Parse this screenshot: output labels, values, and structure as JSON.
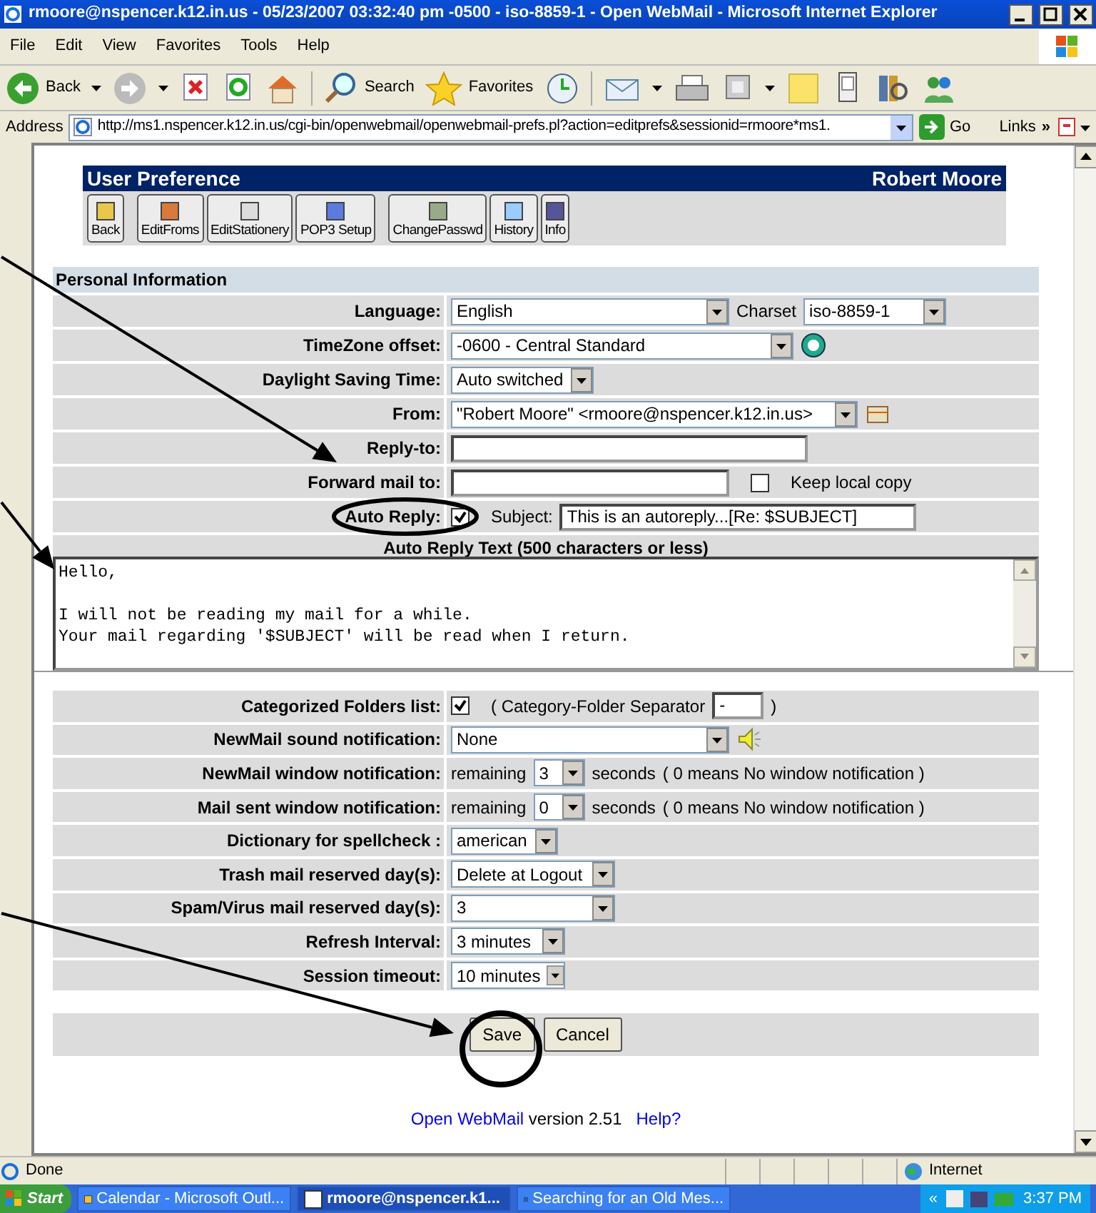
{
  "window": {
    "title": "rmoore@nspencer.k12.in.us - 05/23/2007 03:32:40 pm -0500 - iso-8859-1 - Open WebMail - Microsoft Internet Explorer"
  },
  "menu": [
    "File",
    "Edit",
    "View",
    "Favorites",
    "Tools",
    "Help"
  ],
  "toolbar": [
    {
      "kind": "back",
      "label": "Back"
    },
    {
      "kind": "caret"
    },
    {
      "kind": "forward"
    },
    {
      "kind": "caret"
    },
    {
      "kind": "stop"
    },
    {
      "kind": "refresh"
    },
    {
      "kind": "home"
    },
    {
      "kind": "sep"
    },
    {
      "kind": "search",
      "label": "Search"
    },
    {
      "kind": "favorites",
      "label": "Favorites"
    },
    {
      "kind": "media"
    },
    {
      "kind": "sep"
    },
    {
      "kind": "mail"
    },
    {
      "kind": "caret"
    },
    {
      "kind": "print"
    },
    {
      "kind": "edit"
    },
    {
      "kind": "caret"
    },
    {
      "kind": "note"
    },
    {
      "kind": "device"
    },
    {
      "kind": "research"
    },
    {
      "kind": "messenger"
    }
  ],
  "address": {
    "label": "Address",
    "url": "http://ms1.nspencer.k12.in.us/cgi-bin/openwebmail/openwebmail-prefs.pl?action=editprefs&sessionid=rmoore*ms1.",
    "go": "Go",
    "links": "Links",
    "more": "»"
  },
  "prefs": {
    "title": "User Preference",
    "user": "Robert Moore",
    "tools": [
      "Back",
      "EditFroms",
      "EditStationery",
      "POP3 Setup",
      "ChangePasswd",
      "History",
      "Info"
    ],
    "section": "Personal Information",
    "rows": [
      {
        "label": "Language:",
        "controls": [
          {
            "kind": "select",
            "value": "English"
          },
          {
            "kind": "text",
            "text": "Charset"
          },
          {
            "kind": "select",
            "value": "iso-8859-1"
          }
        ]
      },
      {
        "label": "TimeZone offset:",
        "controls": [
          {
            "kind": "select",
            "value": "-0600 - Central Standard"
          },
          {
            "kind": "icon"
          }
        ]
      },
      {
        "label": "Daylight Saving Time:",
        "controls": [
          {
            "kind": "select",
            "value": "Auto switched"
          }
        ]
      },
      {
        "label": "From:",
        "controls": [
          {
            "kind": "select",
            "value": "\"Robert Moore\" <rmoore@nspencer.k12.in.us>"
          },
          {
            "kind": "icon"
          }
        ]
      },
      {
        "label": "Reply-to:",
        "controls": [
          {
            "kind": "input"
          }
        ]
      },
      {
        "label": "Forward mail to:",
        "controls": [
          {
            "kind": "input"
          },
          {
            "kind": "checkbox",
            "checked": false
          },
          {
            "kind": "text",
            "text": "Keep local copy"
          }
        ]
      },
      {
        "label": "Auto Reply:",
        "controls": [
          {
            "kind": "checkbox",
            "checked": true
          },
          {
            "kind": "text",
            "text": "Subject:"
          },
          {
            "kind": "input",
            "value": "This is an autoreply...[Re: $SUBJECT]"
          }
        ]
      }
    ],
    "autoreply": {
      "label": "Auto Reply Text (500 characters or less)",
      "text": "Hello,\n\nI will not be reading my mail for a while.\nYour mail regarding '$SUBJECT' will be read when I return."
    },
    "rows2": [
      {
        "label": "Categorized Folders list:",
        "controls": [
          {
            "kind": "checkbox",
            "checked": true
          },
          {
            "kind": "text",
            "text": "( Category-Folder Separator"
          },
          {
            "kind": "input",
            "value": "-"
          },
          {
            "kind": "text",
            "text": ")"
          }
        ]
      },
      {
        "label": "NewMail sound notification:",
        "controls": [
          {
            "kind": "select",
            "value": "None"
          },
          {
            "kind": "speaker"
          }
        ]
      },
      {
        "label": "NewMail window notification:",
        "controls": [
          {
            "kind": "text",
            "text": "remaining"
          },
          {
            "kind": "select",
            "value": "3"
          },
          {
            "kind": "text",
            "text": "seconds"
          },
          {
            "kind": "text",
            "text": "( 0 means No window notification )"
          }
        ]
      },
      {
        "label": "Mail sent window notification:",
        "controls": [
          {
            "kind": "text",
            "text": "remaining"
          },
          {
            "kind": "select",
            "value": "0"
          },
          {
            "kind": "text",
            "text": "seconds"
          },
          {
            "kind": "text",
            "text": "( 0 means No window notification )"
          }
        ]
      },
      {
        "label": "Dictionary for spellcheck :",
        "controls": [
          {
            "kind": "select",
            "value": "american"
          }
        ]
      },
      {
        "label": "Trash mail reserved day(s):",
        "controls": [
          {
            "kind": "select",
            "value": "Delete at Logout"
          }
        ]
      },
      {
        "label": "Spam/Virus mail reserved day(s):",
        "controls": [
          {
            "kind": "select",
            "value": "3"
          }
        ]
      },
      {
        "label": "Refresh Interval:",
        "controls": [
          {
            "kind": "select",
            "value": "3 minutes"
          }
        ]
      },
      {
        "label": "Session timeout:",
        "controls": [
          {
            "kind": "select",
            "value": "10 minutes"
          }
        ]
      }
    ],
    "buttons": [
      "Save",
      "Cancel"
    ],
    "footer": {
      "link": "Open WebMail",
      "version": "version 2.51",
      "help": "Help?"
    }
  },
  "status_bar": {
    "text": "Done",
    "zone": "Internet"
  },
  "taskbar": {
    "start": "Start",
    "tasks": [
      {
        "label": "Calendar - Microsoft Outl...",
        "selected": false
      },
      {
        "label": "rmoore@nspencer.k1...",
        "selected": true
      },
      {
        "label": "Searching for an Old Mes...",
        "selected": false
      }
    ],
    "tray": "«",
    "time": "3:37 PM"
  }
}
